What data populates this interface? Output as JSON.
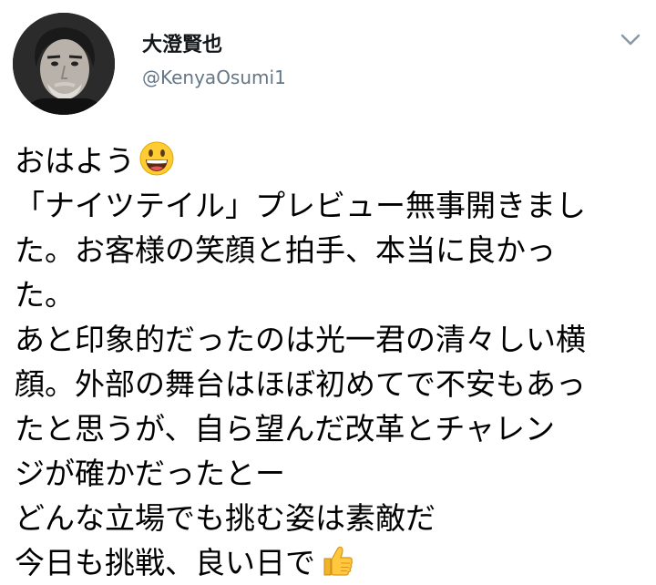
{
  "tweet": {
    "author": {
      "display_name": "大澄賢也",
      "handle": "@KenyaOsumi1",
      "avatar_icon": "user-avatar-photo"
    },
    "menu_icon": "chevron-down-icon",
    "lines": [
      "おはよう",
      "「ナイツテイル」プレビュー無事開きまし",
      "た。お客様の笑顔と拍手、本当に良かっ",
      "た。",
      "あと印象的だったのは光一君の清々しい横",
      "顔。外部の舞台はほぼ初めてで不安もあっ",
      "たと思うが、自ら望んだ改革とチャレン",
      "ジが確かだったとー",
      "どんな立場でも挑む姿は素敵だ",
      "今日も挑戦、良い日で"
    ],
    "emojis": {
      "line_0": "grinning-face-emoji",
      "line_9": "thumbs-up-emoji"
    },
    "colors": {
      "text": "#000000",
      "name": "#14171a",
      "handle": "#657786",
      "chevron": "#8899a6"
    }
  }
}
